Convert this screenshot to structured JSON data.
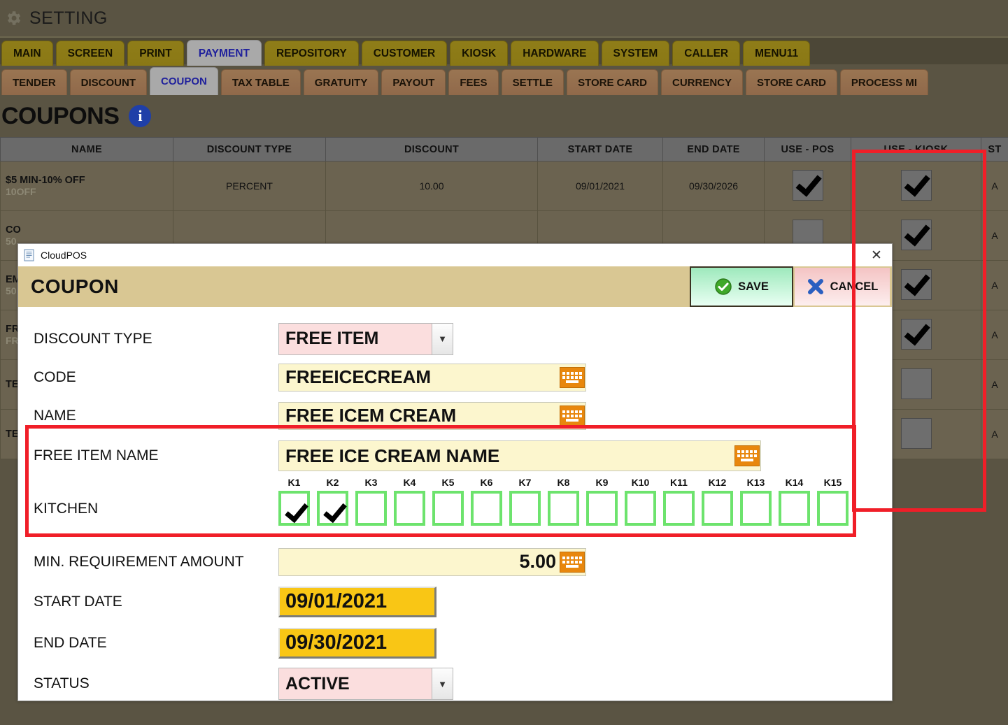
{
  "app": {
    "setting_title": "SETTING",
    "gear_icon": "gear-icon"
  },
  "tabs_primary": [
    {
      "label": "MAIN",
      "active": false
    },
    {
      "label": "SCREEN",
      "active": false
    },
    {
      "label": "PRINT",
      "active": false
    },
    {
      "label": "PAYMENT",
      "active": true
    },
    {
      "label": "REPOSITORY",
      "active": false
    },
    {
      "label": "CUSTOMER",
      "active": false
    },
    {
      "label": "KIOSK",
      "active": false
    },
    {
      "label": "HARDWARE",
      "active": false
    },
    {
      "label": "SYSTEM",
      "active": false
    },
    {
      "label": "CALLER",
      "active": false
    },
    {
      "label": "MENU11",
      "active": false
    }
  ],
  "tabs_secondary": [
    {
      "label": "TENDER",
      "active": false
    },
    {
      "label": "DISCOUNT",
      "active": false
    },
    {
      "label": "COUPON",
      "active": true
    },
    {
      "label": "TAX TABLE",
      "active": false
    },
    {
      "label": "GRATUITY",
      "active": false
    },
    {
      "label": "PAYOUT",
      "active": false
    },
    {
      "label": "FEES",
      "active": false
    },
    {
      "label": "SETTLE",
      "active": false
    },
    {
      "label": "STORE CARD",
      "active": false
    },
    {
      "label": "CURRENCY",
      "active": false
    },
    {
      "label": "STORE CARD",
      "active": false
    },
    {
      "label": "PROCESS MI",
      "active": false
    }
  ],
  "page": {
    "title": "COUPONS",
    "info_icon_label": "i"
  },
  "table": {
    "columns": [
      "NAME",
      "DISCOUNT TYPE",
      "DISCOUNT",
      "START DATE",
      "END DATE",
      "USE - POS",
      "USE - KIOSK",
      "ST"
    ],
    "rows": [
      {
        "name": "$5 MIN-10% OFF",
        "code": "10OFF",
        "discount_type": "PERCENT",
        "discount": "10.00",
        "start_date": "09/01/2021",
        "end_date": "09/30/2026",
        "use_pos": true,
        "use_kiosk": true,
        "status": "A"
      },
      {
        "name": "CO",
        "code": "50",
        "discount_type": "",
        "discount": "",
        "start_date": "",
        "end_date": "",
        "use_pos": false,
        "use_kiosk": true,
        "status": "A"
      },
      {
        "name": "EM",
        "code": "50",
        "discount_type": "",
        "discount": "",
        "start_date": "",
        "end_date": "",
        "use_pos": false,
        "use_kiosk": true,
        "status": "A"
      },
      {
        "name": "FR",
        "code": "FR",
        "discount_type": "",
        "discount": "",
        "start_date": "",
        "end_date": "",
        "use_pos": false,
        "use_kiosk": true,
        "status": "A"
      },
      {
        "name": "TE",
        "code": "",
        "discount_type": "",
        "discount": "",
        "start_date": "",
        "end_date": "",
        "use_pos": false,
        "use_kiosk": false,
        "status": "A"
      },
      {
        "name": "TE",
        "code": "",
        "discount_type": "",
        "discount": "",
        "start_date": "",
        "end_date": "",
        "use_pos": false,
        "use_kiosk": false,
        "status": "A"
      }
    ]
  },
  "modal": {
    "window_title": "CloudPOS",
    "window_icon": "document-icon",
    "close_icon": "close-icon",
    "heading": "COUPON",
    "save_label": "SAVE",
    "save_icon": "check-circle-icon",
    "cancel_label": "CANCEL",
    "cancel_icon": "x-mark-icon",
    "fields": {
      "discount_type_label": "DISCOUNT TYPE",
      "discount_type_value": "FREE ITEM",
      "code_label": "CODE",
      "code_value": "FREEICECREAM",
      "name_label": "NAME",
      "name_value": "FREE ICEM CREAM",
      "free_item_name_label": "FREE ITEM NAME",
      "free_item_name_value": "FREE ICE CREAM NAME",
      "kitchen_label": "KITCHEN",
      "min_requirement_label": "MIN. REQUIREMENT AMOUNT",
      "min_requirement_value": "5.00",
      "start_date_label": "START DATE",
      "start_date_value": "09/01/2021",
      "end_date_label": "END DATE",
      "end_date_value": "09/30/2021",
      "status_label": "STATUS",
      "status_value": "ACTIVE"
    },
    "kitchen": [
      {
        "label": "K1",
        "checked": true
      },
      {
        "label": "K2",
        "checked": true
      },
      {
        "label": "K3",
        "checked": false
      },
      {
        "label": "K4",
        "checked": false
      },
      {
        "label": "K5",
        "checked": false
      },
      {
        "label": "K6",
        "checked": false
      },
      {
        "label": "K7",
        "checked": false
      },
      {
        "label": "K8",
        "checked": false
      },
      {
        "label": "K9",
        "checked": false
      },
      {
        "label": "K10",
        "checked": false
      },
      {
        "label": "K11",
        "checked": false
      },
      {
        "label": "K12",
        "checked": false
      },
      {
        "label": "K13",
        "checked": false
      },
      {
        "label": "K14",
        "checked": false
      },
      {
        "label": "K15",
        "checked": false
      }
    ]
  },
  "annotations": {
    "color": "#f01e28",
    "boxes": [
      "use-kiosk-column-highlight",
      "kitchen-section-highlight"
    ]
  },
  "colors": {
    "background": "#5a5443",
    "primary_tab": "#8f7d18",
    "secondary_tab": "#9a7552",
    "active_tab": "#a9a9a9",
    "active_tab_text": "#20219c",
    "modal_header": "#d9c793",
    "input_yellow": "#fcf6ce",
    "select_pink": "#fbdede",
    "date_gold": "#f9c615",
    "kitchen_border_green": "#6de36d",
    "keyboard_orange": "#e8870d"
  }
}
